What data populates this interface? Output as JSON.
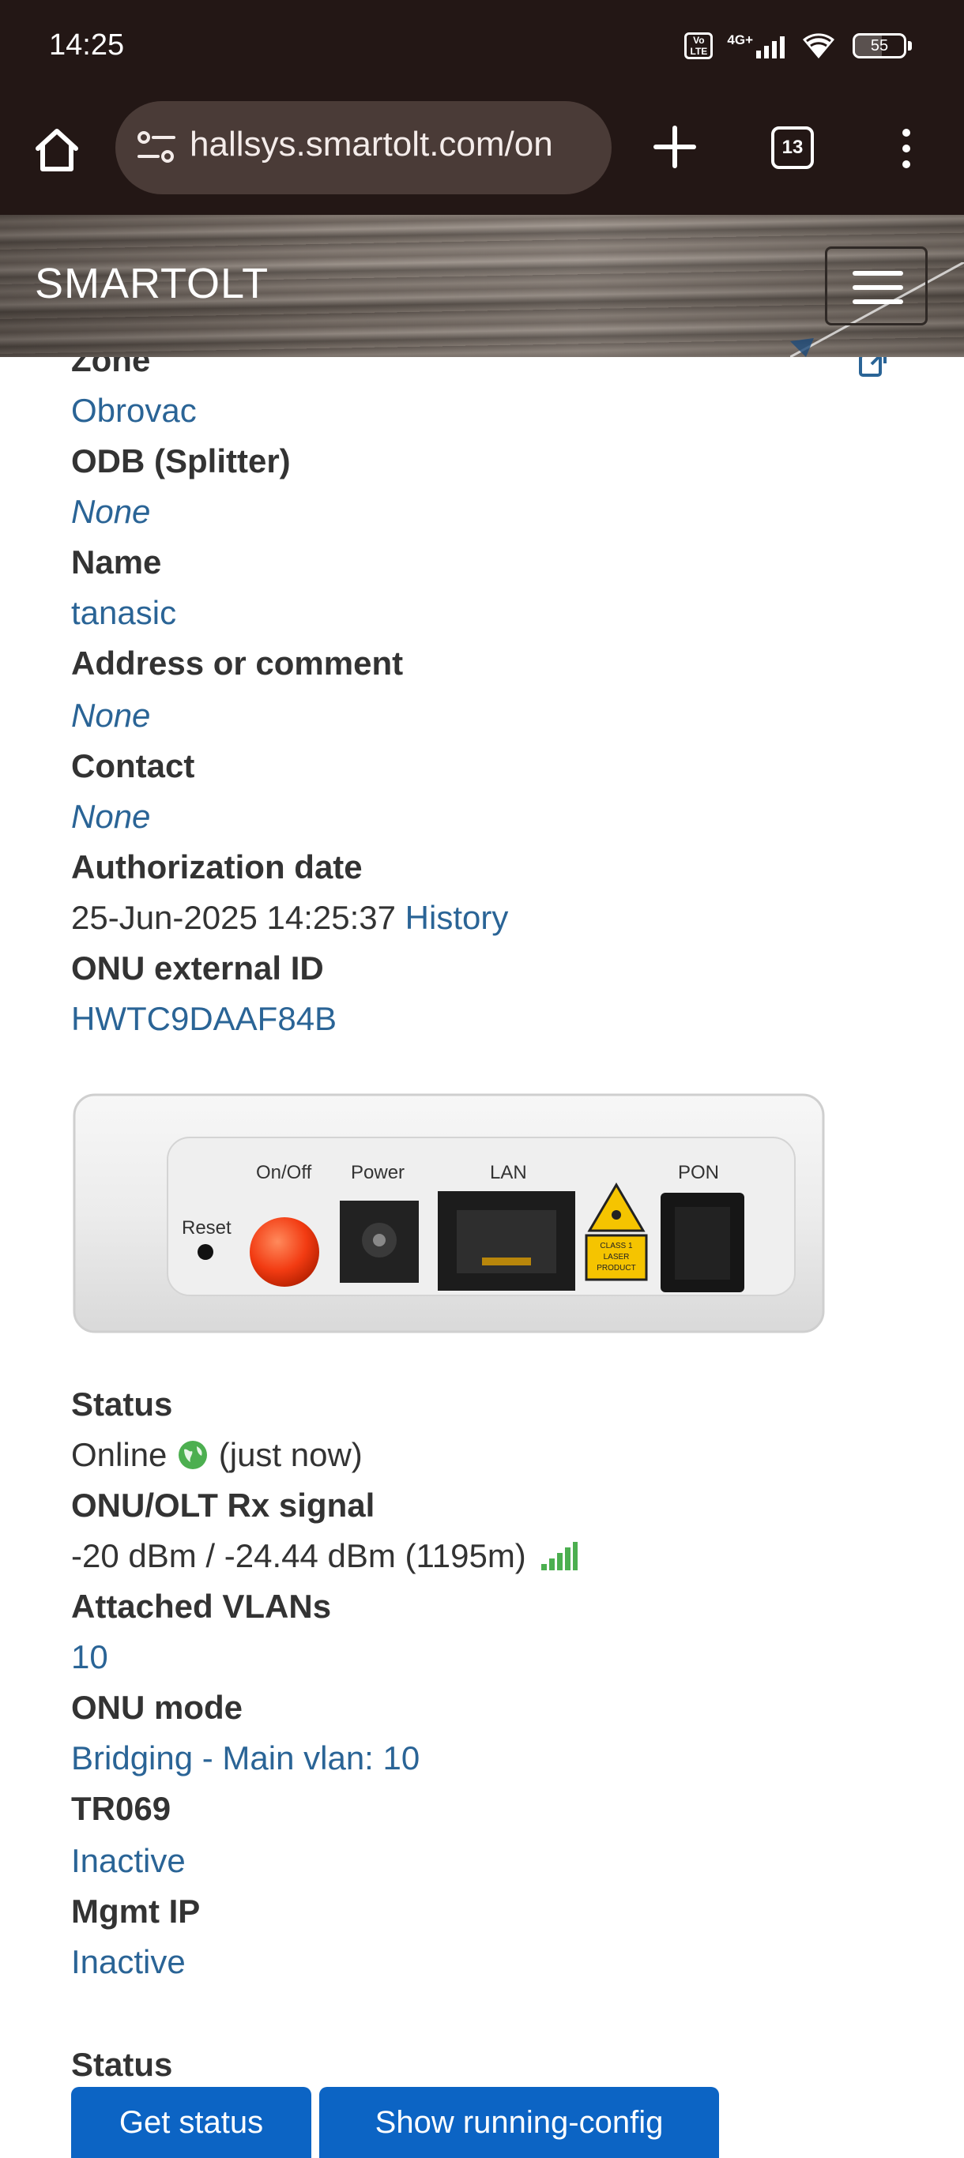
{
  "status_bar": {
    "time": "14:25",
    "volte_label": "Vo LTE",
    "network_label": "4G+",
    "battery_percent": 55,
    "battery_label": "55"
  },
  "browser": {
    "url": "hallsys.smartolt.com/on",
    "tab_count": "13"
  },
  "app": {
    "brand": "SMARTOLT"
  },
  "details": {
    "zone_label": "Zone",
    "zone_value": "Obrovac",
    "odb_label": "ODB (Splitter)",
    "odb_value": "None",
    "name_label": "Name",
    "name_value": "tanasic",
    "address_label": "Address or comment",
    "address_value": "None",
    "contact_label": "Contact",
    "contact_value": "None",
    "auth_label": "Authorization date",
    "auth_value": "25-Jun-2025 14:25:37",
    "auth_history_link": "History",
    "ext_id_label": "ONU external ID",
    "ext_id_value": "HWTC9DAAF84B"
  },
  "device_image": {
    "reset": "Reset",
    "onoff": "On/Off",
    "power": "Power",
    "lan": "LAN",
    "pon": "PON",
    "laser_1": "CLASS 1",
    "laser_2": "LASER",
    "laser_3": "PRODUCT"
  },
  "status_info": {
    "status_label": "Status",
    "status_value": "Online",
    "status_time": "(just now)",
    "signal_label": "ONU/OLT Rx signal",
    "signal_value": "-20 dBm / -24.44 dBm (1195m)",
    "vlans_label": "Attached VLANs",
    "vlans_value": "10",
    "mode_label": "ONU mode",
    "mode_value": "Bridging - Main vlan: 10",
    "tr069_label": "TR069",
    "tr069_value": "Inactive",
    "mgmt_label": "Mgmt IP",
    "mgmt_value": "Inactive"
  },
  "actions": {
    "section_label": "Status",
    "get_status": "Get status",
    "show_config": "Show running-config"
  },
  "colors": {
    "link": "#2a6496",
    "primary_button": "#0c64c4",
    "online_green": "#4caf50"
  }
}
